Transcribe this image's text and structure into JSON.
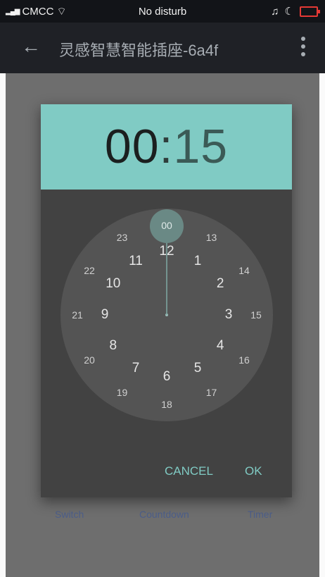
{
  "status_bar": {
    "carrier": "CMCC",
    "center_text": "No disturb"
  },
  "app_bar": {
    "title": "灵感智慧智能插座-6a4f"
  },
  "tabs": [
    {
      "label": "Switch"
    },
    {
      "label": "Countdown"
    },
    {
      "label": "Timer"
    }
  ],
  "dialog": {
    "hours": "00",
    "separator": ":",
    "minutes": "15",
    "cancel_label": "CANCEL",
    "ok_label": "OK",
    "selected_value": "00",
    "accent_color": "#80cbc4",
    "outer_numbers": [
      "12",
      "1",
      "2",
      "3",
      "4",
      "5",
      "6",
      "7",
      "8",
      "9",
      "10",
      "11"
    ],
    "inner_numbers": [
      "00",
      "13",
      "14",
      "15",
      "16",
      "17",
      "18",
      "19",
      "20",
      "21",
      "22",
      "23"
    ]
  }
}
